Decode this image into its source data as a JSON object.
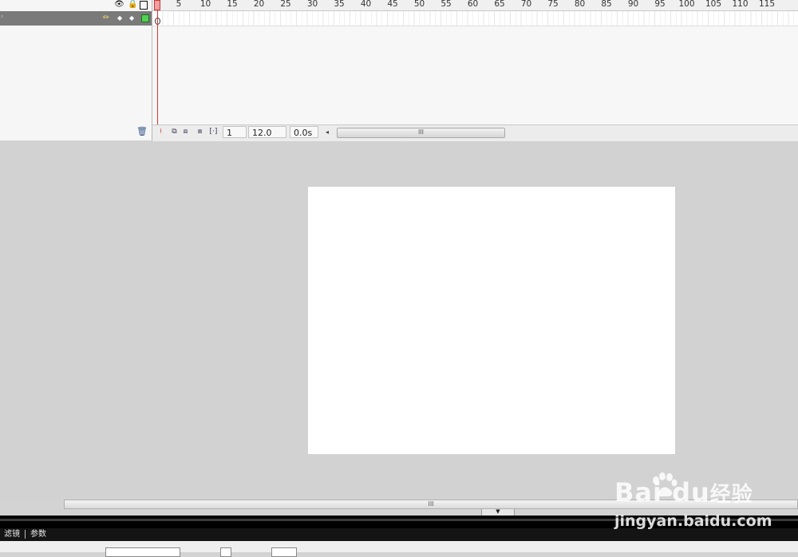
{
  "timeline": {
    "header_icons": [
      "eye-icon",
      "lock-icon",
      "outline-icon"
    ],
    "layer": {
      "icons": [
        "pencil-icon",
        "visibility-dot-icon",
        "lock-dot-icon",
        "outline-square-icon"
      ],
      "outline_color": "#52d152"
    },
    "ruler_labels": [
      "5",
      "10",
      "15",
      "20",
      "25",
      "30",
      "35",
      "40",
      "45",
      "50",
      "55",
      "60",
      "65",
      "70",
      "75",
      "80",
      "85",
      "90",
      "95",
      "100",
      "105",
      "110",
      "115"
    ],
    "status": {
      "current_frame": "1",
      "frame_rate": "12.0 fps",
      "elapsed_time": "0.0s",
      "scroll_grip": "III"
    },
    "playhead_color": "#dd3333"
  },
  "stage": {
    "background": "#ffffff",
    "pasteboard": "#d2d2d2"
  },
  "bottom": {
    "scroll_grip": "III",
    "collapse_arrow": "▼",
    "tabs": [
      "滤镜",
      "参数"
    ]
  },
  "watermark": {
    "brand": "Bai  du",
    "brand_suffix": "经验",
    "url": "jingyan.baidu.com"
  }
}
